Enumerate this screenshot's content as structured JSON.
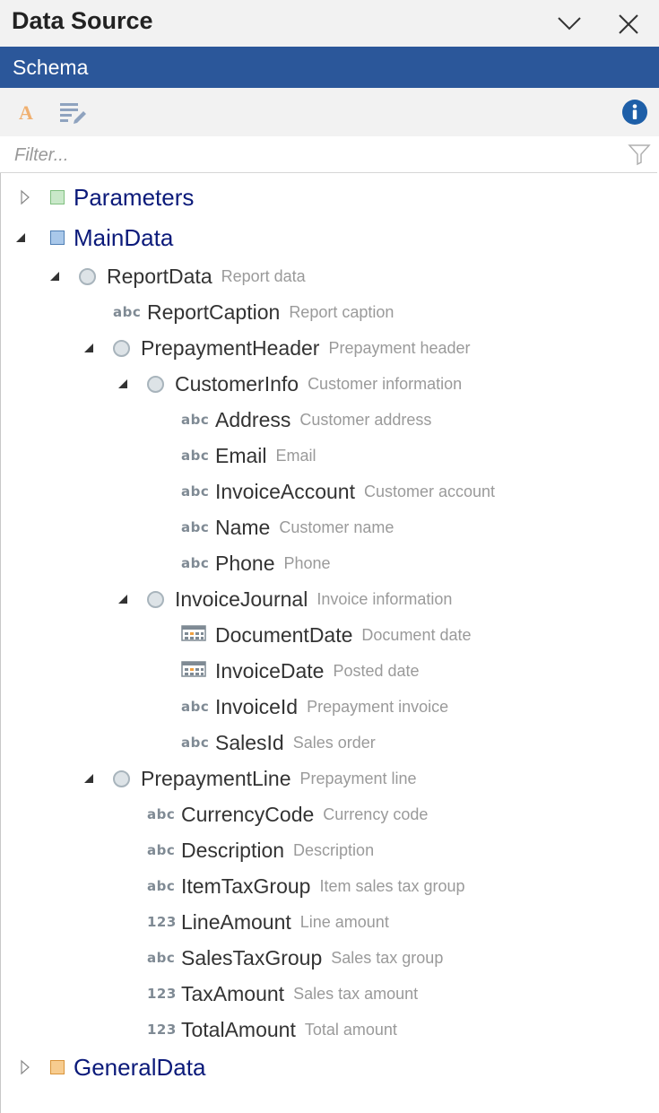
{
  "window": {
    "title": "Data Source",
    "collapse_icon": "chevron-down-icon",
    "close_icon": "close-icon"
  },
  "tab": {
    "label": "Schema"
  },
  "toolbar": {
    "font_icon": "font-a-icon",
    "edit_list_icon": "edit-list-icon",
    "info_icon": "info-icon"
  },
  "filter": {
    "placeholder": "Filter...",
    "value": ""
  },
  "colors": {
    "accent": "#2b579a",
    "parameters_box": "#c9e8c9",
    "maindata_box": "#a9c8ea",
    "generaldata_box": "#f7cc8f"
  },
  "tree": {
    "parameters": {
      "label": "Parameters"
    },
    "maindata": {
      "label": "MainData"
    },
    "report_data": {
      "label": "ReportData",
      "desc": "Report data"
    },
    "report_caption": {
      "label": "ReportCaption",
      "desc": "Report caption",
      "type": "abc"
    },
    "prepayment_header": {
      "label": "PrepaymentHeader",
      "desc": "Prepayment header"
    },
    "customer_info": {
      "label": "CustomerInfo",
      "desc": "Customer information"
    },
    "address": {
      "label": "Address",
      "desc": "Customer address",
      "type": "abc"
    },
    "email": {
      "label": "Email",
      "desc": "Email",
      "type": "abc"
    },
    "invoice_account": {
      "label": "InvoiceAccount",
      "desc": "Customer account",
      "type": "abc"
    },
    "name": {
      "label": "Name",
      "desc": "Customer name",
      "type": "abc"
    },
    "phone": {
      "label": "Phone",
      "desc": "Phone",
      "type": "abc"
    },
    "invoice_journal": {
      "label": "InvoiceJournal",
      "desc": "Invoice information"
    },
    "document_date": {
      "label": "DocumentDate",
      "desc": "Document date"
    },
    "invoice_date": {
      "label": "InvoiceDate",
      "desc": "Posted date"
    },
    "invoice_id": {
      "label": "InvoiceId",
      "desc": "Prepayment invoice",
      "type": "abc"
    },
    "sales_id": {
      "label": "SalesId",
      "desc": "Sales order",
      "type": "abc"
    },
    "prepayment_line": {
      "label": "PrepaymentLine",
      "desc": "Prepayment line"
    },
    "currency_code": {
      "label": "CurrencyCode",
      "desc": "Currency code",
      "type": "abc"
    },
    "description": {
      "label": "Description",
      "desc": "Description",
      "type": "abc"
    },
    "item_tax_group": {
      "label": "ItemTaxGroup",
      "desc": "Item sales tax group",
      "type": "abc"
    },
    "line_amount": {
      "label": "LineAmount",
      "desc": "Line amount",
      "type": "123"
    },
    "sales_tax_group": {
      "label": "SalesTaxGroup",
      "desc": "Sales tax group",
      "type": "abc"
    },
    "tax_amount": {
      "label": "TaxAmount",
      "desc": "Sales tax amount",
      "type": "123"
    },
    "total_amount": {
      "label": "TotalAmount",
      "desc": "Total amount",
      "type": "123"
    },
    "generaldata": {
      "label": "GeneralData"
    }
  }
}
